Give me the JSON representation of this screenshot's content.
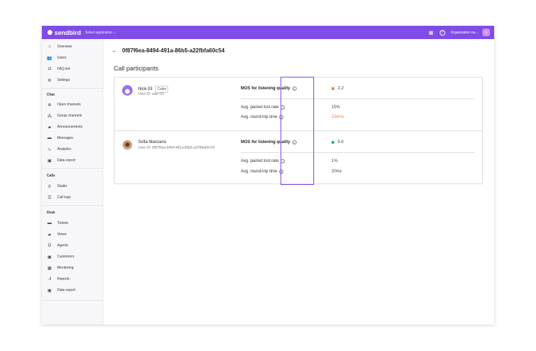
{
  "topbar": {
    "brand": "sendbird",
    "app_select": "Select application ⌄",
    "org_name": "Organization na...",
    "grid_icon": "grid-icon",
    "help_icon": "help-icon",
    "avatar_icon": "user-avatar-icon",
    "accent": "#7f4ce8"
  },
  "sidebar": {
    "main_items": [
      {
        "label": "Overview",
        "icon": "home-icon"
      },
      {
        "label": "Users",
        "icon": "users-icon"
      },
      {
        "label": "FAQ bot",
        "icon": "bot-icon"
      },
      {
        "label": "Settings",
        "icon": "gear-icon"
      }
    ],
    "chat_title": "Chat",
    "chat_items": [
      {
        "label": "Open channels",
        "icon": "open-channels-icon"
      },
      {
        "label": "Group channels",
        "icon": "group-channels-icon"
      },
      {
        "label": "Announcements",
        "icon": "megaphone-icon"
      },
      {
        "label": "Messages",
        "icon": "message-icon"
      },
      {
        "label": "Analytics",
        "icon": "analytics-icon"
      },
      {
        "label": "Data export",
        "icon": "export-icon"
      }
    ],
    "calls_title": "Calls",
    "calls_items": [
      {
        "label": "Studio",
        "icon": "phone-icon"
      },
      {
        "label": "Call logs",
        "icon": "list-icon"
      }
    ],
    "desk_title": "Desk",
    "desk_items": [
      {
        "label": "Tickets",
        "icon": "ticket-icon"
      },
      {
        "label": "Views",
        "icon": "views-icon"
      },
      {
        "label": "Agents",
        "icon": "headset-icon"
      },
      {
        "label": "Customers",
        "icon": "customer-icon"
      },
      {
        "label": "Monitoring",
        "icon": "monitor-icon"
      },
      {
        "label": "Reports",
        "icon": "bar-chart-icon"
      },
      {
        "label": "Data export",
        "icon": "export-icon"
      }
    ]
  },
  "main": {
    "call_id": "0f87f6ea-8494-491a-86b5-a22fbfa60c54",
    "section_title": "Call participants",
    "participants": [
      {
        "name": "Nick-03",
        "badge": "Caller",
        "user_id": "User ID: user-03",
        "mos_label": "MOS for listening quality",
        "mos_value": "2.2",
        "mos_color": "#f5843d",
        "packet_label": "Avg. packet lost rate",
        "packet_value": "15%",
        "packet_color": "#444444",
        "rtt_label": "Avg. round-trip time",
        "rtt_value": "234ms",
        "rtt_color": "#f5843d"
      },
      {
        "name": "Sofia Manzano",
        "user_id": "User ID: 0f87f6ea-8494-491a-86b5-a22fbfa60c54",
        "mos_label": "MOS for listening quality",
        "mos_value": "5.0",
        "mos_color": "#18b79e",
        "packet_label": "Avg. packet lost rate",
        "packet_value": "1%",
        "packet_color": "#444444",
        "rtt_label": "Avg. round-trip time",
        "rtt_value": "20ms",
        "rtt_color": "#444444"
      }
    ],
    "highlight_color": "#7b3ff2"
  }
}
